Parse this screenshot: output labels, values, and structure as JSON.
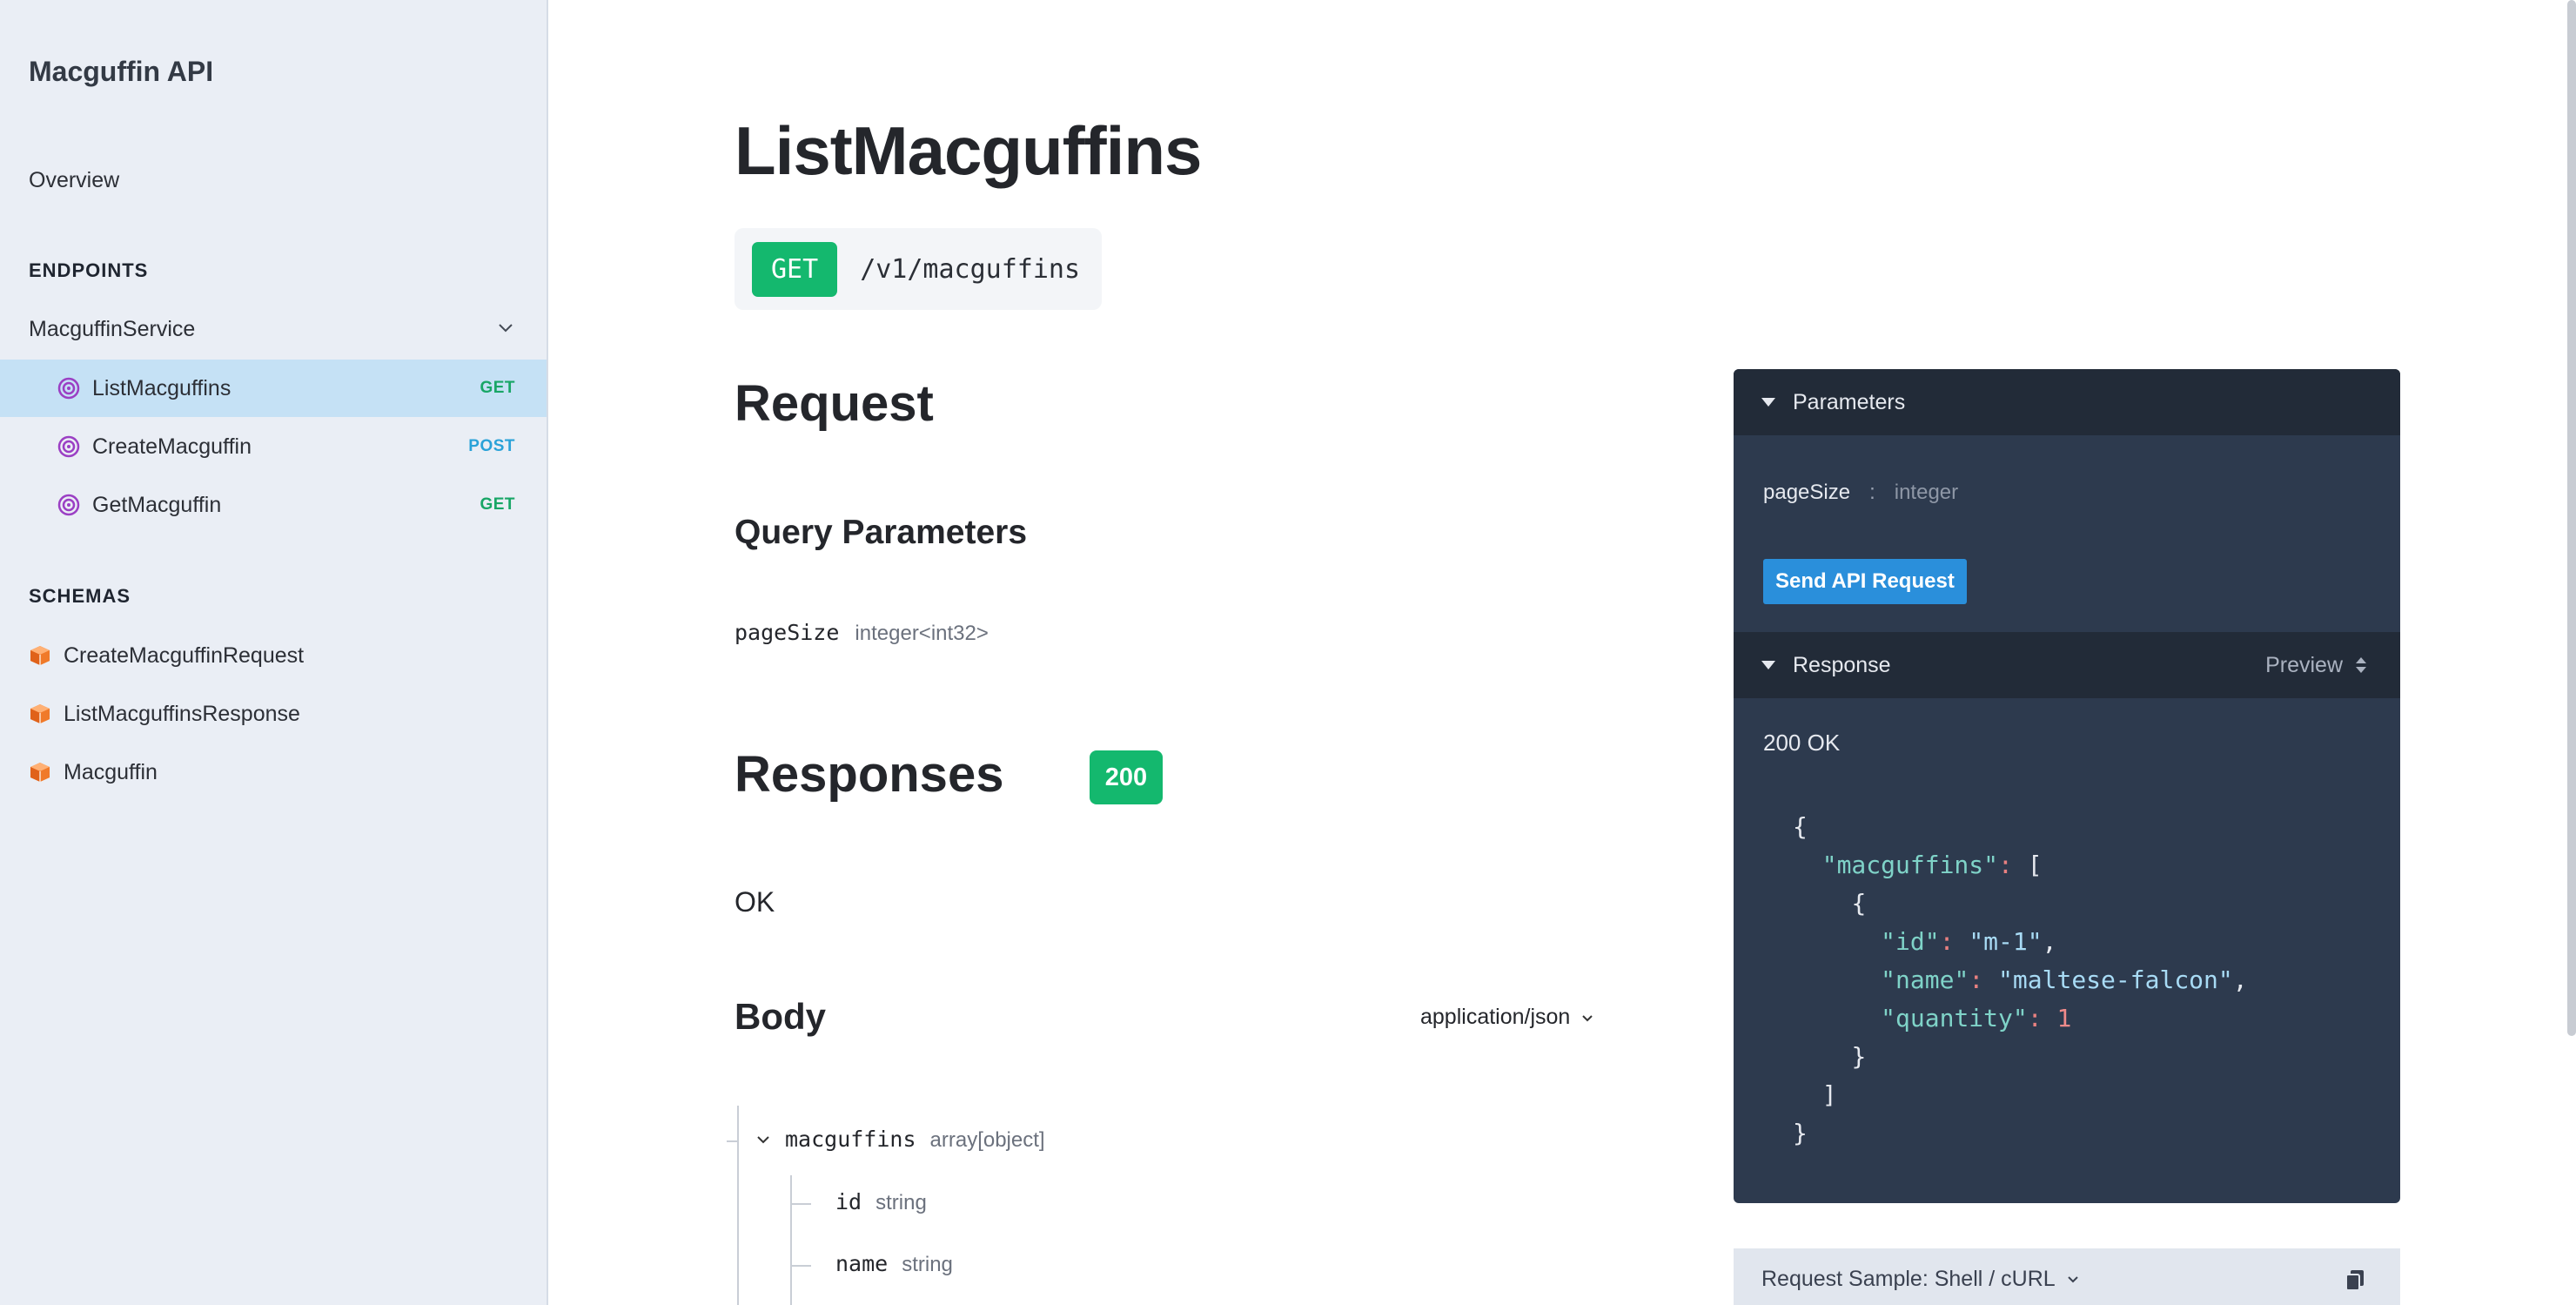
{
  "sidebar": {
    "brand": "Macguffin API",
    "overview": "Overview",
    "endpoints_label": "ENDPOINTS",
    "service": "MacguffinService",
    "endpoints": [
      {
        "label": "ListMacguffins",
        "method": "GET"
      },
      {
        "label": "CreateMacguffin",
        "method": "POST"
      },
      {
        "label": "GetMacguffin",
        "method": "GET"
      }
    ],
    "schemas_label": "SCHEMAS",
    "schemas": [
      {
        "label": "CreateMacguffinRequest"
      },
      {
        "label": "ListMacguffinsResponse"
      },
      {
        "label": "Macguffin"
      }
    ]
  },
  "main": {
    "title": "ListMacguffins",
    "method": "GET",
    "path": "/v1/macguffins",
    "request_heading": "Request",
    "query_heading": "Query Parameters",
    "query_params": [
      {
        "name": "pageSize",
        "type": "integer<int32>"
      }
    ],
    "responses_heading": "Responses",
    "status_code": "200",
    "status_text": "OK",
    "body_heading": "Body",
    "content_type": "application/json",
    "body_fields": {
      "root": {
        "name": "macguffins",
        "type": "array[object]"
      },
      "children": [
        {
          "name": "id",
          "type": "string"
        },
        {
          "name": "name",
          "type": "string"
        }
      ]
    }
  },
  "panel": {
    "parameters_label": "Parameters",
    "param_name": "pageSize",
    "param_colon": ":",
    "param_type": "integer",
    "send_button": "Send API Request",
    "response_label": "Response",
    "preview_label": "Preview",
    "response_status": "200 OK",
    "json": {
      "open_brace": "{",
      "key_macguffins": "\"macguffins\"",
      "open_bracket": "[",
      "open_obj": "{",
      "key_id": "\"id\"",
      "val_id": "\"m-1\"",
      "key_name": "\"name\"",
      "val_name": "\"maltese-falcon\"",
      "key_quantity": "\"quantity\"",
      "val_quantity": "1",
      "close_obj": "}",
      "close_bracket": "]",
      "close_brace": "}"
    },
    "sample_label": "Request Sample: Shell / cURL"
  },
  "colors": {
    "get": "#18a666",
    "post": "#2aa2d8",
    "badge_green": "#14b86e",
    "panel_bg": "#2d3a4e",
    "send_btn": "#2a8fdb"
  },
  "icons": {
    "endpoint": "target-icon",
    "schema": "cube-icon",
    "chevron": "chevron-down-icon",
    "copy": "copy-icon"
  }
}
